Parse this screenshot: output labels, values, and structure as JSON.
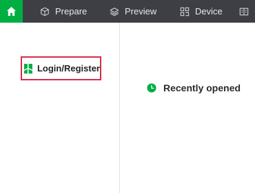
{
  "nav": {
    "tabs": [
      {
        "label": "Prepare",
        "icon": "cube-icon"
      },
      {
        "label": "Preview",
        "icon": "layers-icon"
      },
      {
        "label": "Device",
        "icon": "device-icon"
      },
      {
        "label": "",
        "icon": "project-icon"
      }
    ],
    "home_icon": "home-icon"
  },
  "sidebar": {
    "login_label": "Login/Register",
    "logo_icon": "bambu-logo"
  },
  "main": {
    "recent_label": "Recently opened",
    "recent_icon": "clock-icon"
  },
  "colors": {
    "topbar": "#3e3f44",
    "accent": "#00ae42",
    "highlight_border": "#d62c43"
  }
}
